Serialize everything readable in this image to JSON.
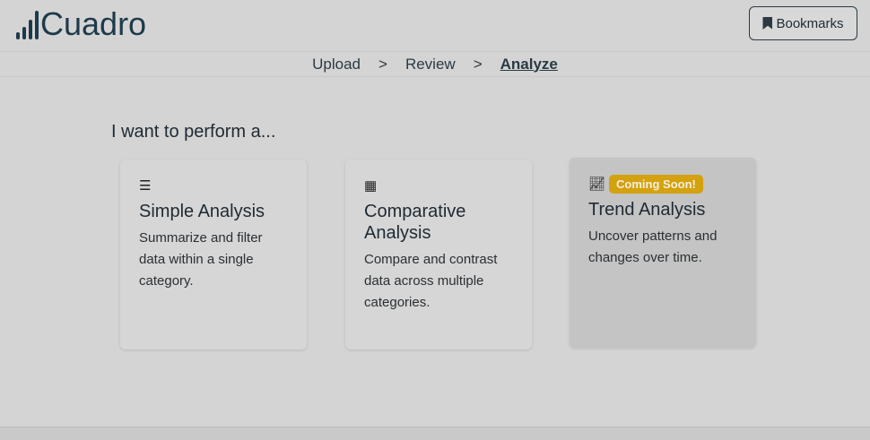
{
  "app": {
    "name": "Cuadro"
  },
  "header": {
    "bookmarks_label": "Bookmarks"
  },
  "breadcrumb": {
    "steps": [
      "Upload",
      "Review",
      "Analyze"
    ],
    "separator": ">"
  },
  "prompt": "I want to perform a...",
  "cards": [
    {
      "icon": "bar-list-icon",
      "title": "Simple Analysis",
      "description": "Summarize and filter data within a single category."
    },
    {
      "icon": "table-icon",
      "title": "Comparative Analysis",
      "description": "Compare and contrast data across multiple categories."
    },
    {
      "icon": "line-chart-icon",
      "badge": "Coming Soon!",
      "title": "Trend Analysis",
      "description": "Uncover patterns and changes over time."
    }
  ],
  "colors": {
    "badge": "#d4a10f",
    "brand": "#1e3a4a"
  }
}
